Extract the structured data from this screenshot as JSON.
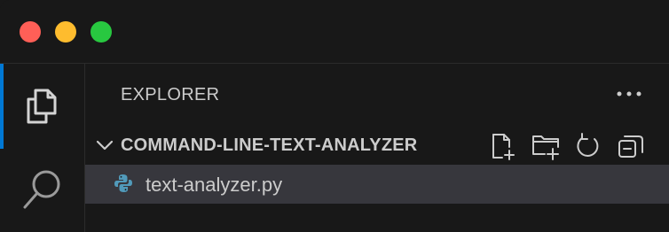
{
  "window": {
    "traffic_lights": {
      "close_color": "#ff5f57",
      "minimize_color": "#febc2e",
      "maximize_color": "#28c840"
    }
  },
  "activitybar": {
    "items": [
      {
        "name": "explorer",
        "icon": "files-icon",
        "active": true
      },
      {
        "name": "search",
        "icon": "search-icon",
        "active": false
      }
    ],
    "accent_color": "#0078d4"
  },
  "sidebar": {
    "title": "EXPLORER",
    "more_icon": "ellipsis-icon",
    "folder": {
      "name": "COMMAND-LINE-TEXT-ANALYZER",
      "expanded": true,
      "actions": [
        {
          "name": "new-file",
          "icon": "new-file-icon"
        },
        {
          "name": "new-folder",
          "icon": "new-folder-icon"
        },
        {
          "name": "refresh",
          "icon": "refresh-icon"
        },
        {
          "name": "collapse-all",
          "icon": "collapse-all-icon"
        }
      ]
    },
    "files": [
      {
        "name": "text-analyzer.py",
        "icon": "python-icon",
        "selected": true
      }
    ]
  },
  "colors": {
    "background": "#181818",
    "selected_row": "#37373d",
    "text": "#cccccc",
    "python_blue": "#519aba"
  }
}
